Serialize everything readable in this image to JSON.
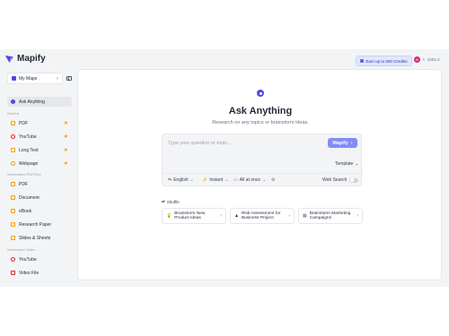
{
  "brand": {
    "name": "Mapify",
    "accent": "#4f46e5"
  },
  "header": {
    "credits_button": "Earn up to 500 Credits!",
    "user": {
      "avatar_letter": "B",
      "credits": "1004.3"
    }
  },
  "sidebar": {
    "maps_select": "My Maps",
    "items_top": [
      {
        "label": "Ask Anything",
        "icon": "ask-icon",
        "active": true
      }
    ],
    "starred_label": "Starred",
    "starred": [
      {
        "label": "PDF",
        "icon": "pdf-icon"
      },
      {
        "label": "YouTube",
        "icon": "youtube-icon"
      },
      {
        "label": "Long Text",
        "icon": "text-icon"
      },
      {
        "label": "Webpage",
        "icon": "webpage-icon"
      }
    ],
    "summarize_docs_label": "Summarize PDF/Doc",
    "summarize_docs": [
      {
        "label": "PDF"
      },
      {
        "label": "Document"
      },
      {
        "label": "eBook"
      },
      {
        "label": "Research Paper"
      },
      {
        "label": "Slides & Sheets"
      }
    ],
    "summarize_video_label": "Summarize Video",
    "summarize_video": [
      {
        "label": "YouTube"
      },
      {
        "label": "Video File"
      }
    ]
  },
  "main": {
    "title": "Ask Anything",
    "subtitle": "Research on any topics or brainstorm ideas.",
    "prompt": {
      "placeholder": "Type your question or topic...",
      "value": "",
      "submit": "Mapify",
      "template": "Template",
      "language": "English",
      "mode": "Instant",
      "layout": "All at once",
      "web_search": "Web Search",
      "web_search_enabled": false
    },
    "shuffle": "Shuffle",
    "suggestions": [
      {
        "text": "Brainstorm New Product Ideas",
        "icon": "lightbulb-icon"
      },
      {
        "text": "Risk Assessment for Business Project",
        "icon": "warning-icon"
      },
      {
        "text": "Brainstorm Marketing Campaigns",
        "icon": "grid-icon"
      }
    ]
  }
}
